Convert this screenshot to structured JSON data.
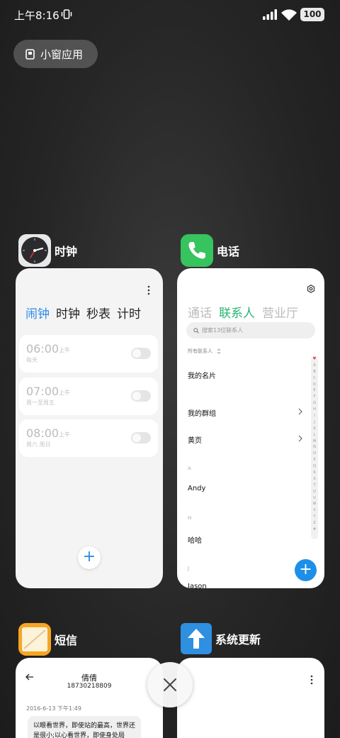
{
  "status": {
    "time": "上午8:16",
    "battery": "100"
  },
  "small_window": {
    "label": "小窗应用"
  },
  "apps": {
    "clock": {
      "name": "时钟",
      "tabs": [
        "闹钟",
        "时钟",
        "秒表",
        "计时"
      ],
      "alarms": [
        {
          "time": "06:00",
          "ampm": "上午",
          "repeat": "每天"
        },
        {
          "time": "07:00",
          "ampm": "上午",
          "repeat": "周一至周五"
        },
        {
          "time": "08:00",
          "ampm": "上午",
          "repeat": "周六 周日"
        }
      ],
      "add_label": "+"
    },
    "phone": {
      "name": "电话",
      "tabs": [
        "通话",
        "联系人",
        "营业厅"
      ],
      "search_placeholder": "搜索13位联系人",
      "all_contacts": "所有联系人",
      "items": {
        "my_card": "我的名片",
        "my_groups": "我的群组",
        "yellow_pages": "黄页",
        "header_a": "A",
        "andy": "Andy",
        "header_h": "H",
        "haha": "哈哈",
        "header_j": "J",
        "jason": "Jason"
      },
      "index_letters": [
        "A",
        "B",
        "C",
        "D",
        "E",
        "F",
        "G",
        "H",
        "I",
        "J",
        "K",
        "L",
        "M",
        "N",
        "O",
        "P",
        "Q",
        "R",
        "S",
        "T",
        "U",
        "V",
        "W",
        "X",
        "Y",
        "Z",
        "#"
      ],
      "add_label": "+"
    },
    "sms": {
      "name": "短信",
      "contact": "倩倩",
      "number": "18730218809",
      "date": "2016-6-13 下午1:49",
      "message": "以眼看世界，即使站的最高，世界还是很小;以心看世界，即使身处局限，世界也很大。"
    },
    "update": {
      "name": "系统更新"
    }
  },
  "colors": {
    "clock_accent": "#2d8ae6",
    "phone_accent": "#2ab56f",
    "phone_fab": "#1e8fe8",
    "phone_icon": "#37c35e",
    "update_icon": "#2f8fe0"
  },
  "icons": [
    "vibrate-icon",
    "signal-icon",
    "wifi-icon",
    "small-window-icon",
    "gear-icon",
    "search-icon",
    "chevron-right-icon",
    "back-arrow-icon",
    "close-icon",
    "arrow-up-icon",
    "phone-handset-icon",
    "clock-face-icon",
    "notepad-icon"
  ]
}
